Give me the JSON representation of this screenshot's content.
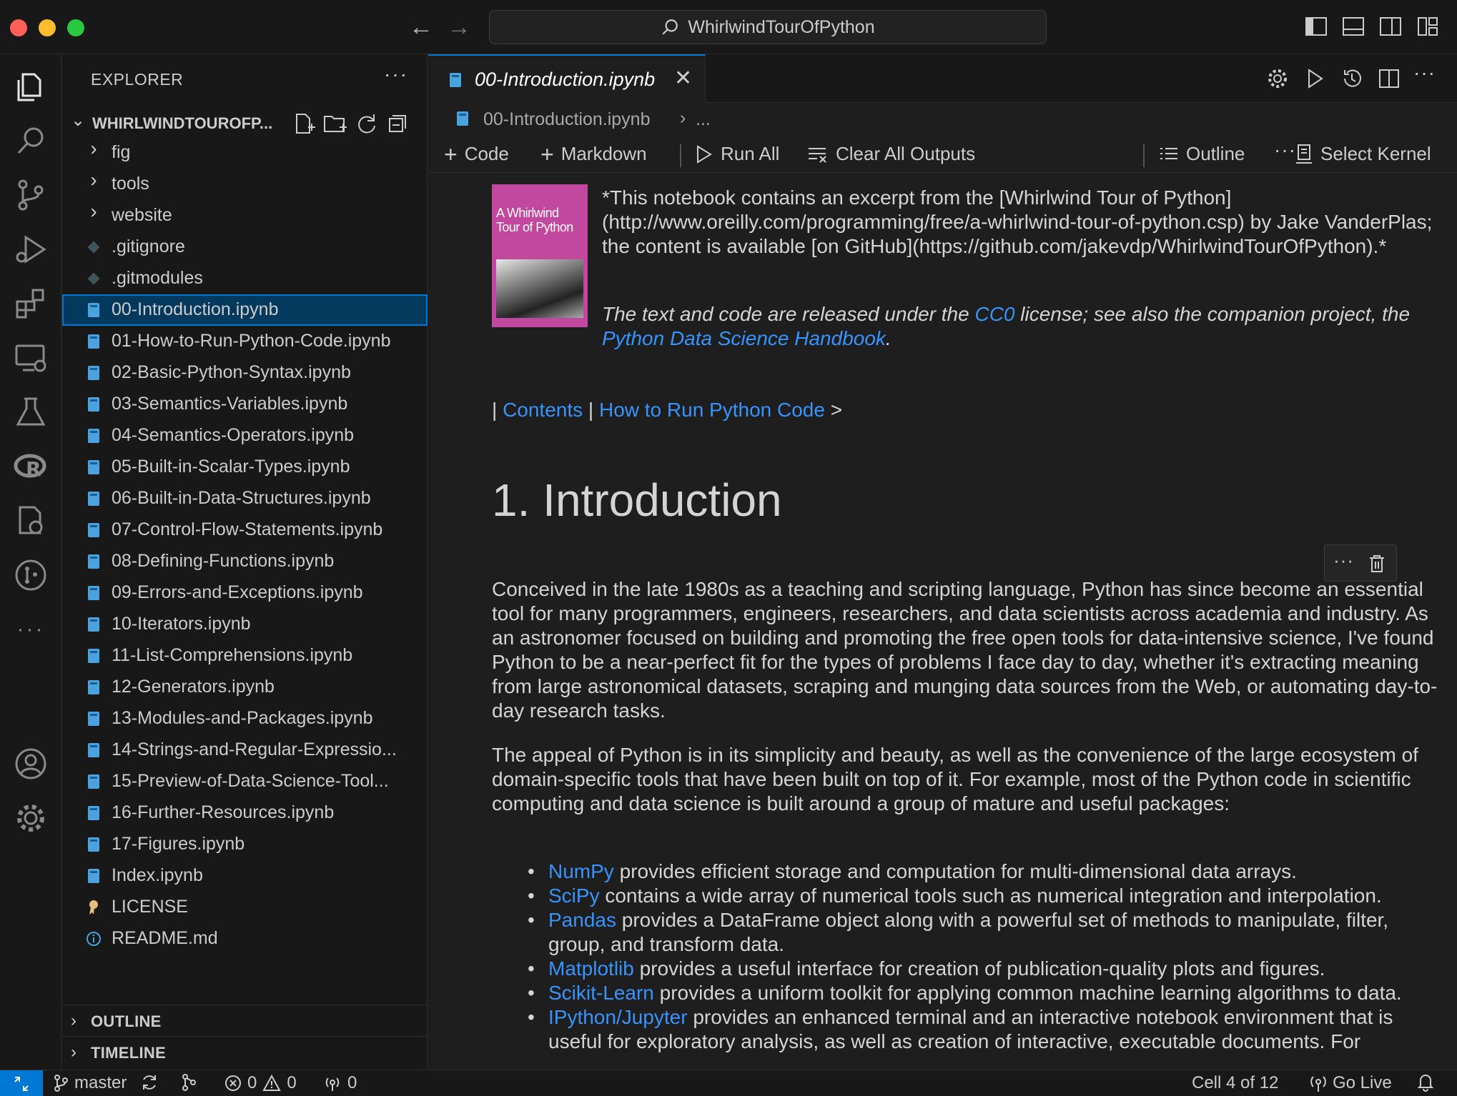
{
  "titlebar": {
    "search_text": "WhirlwindTourOfPython",
    "traffic_lights": {
      "close": "#ff5f57",
      "minimize": "#febc2e",
      "maximize": "#28c840"
    }
  },
  "activity_bar": {
    "icons": [
      "explorer-icon",
      "search-icon",
      "source-control-icon",
      "run-debug-icon",
      "extensions-icon",
      "remote-explorer-icon",
      "testing-icon",
      "r-icon",
      "settings-sync-icon",
      "git-graph-icon",
      "more-icon"
    ],
    "more": "···",
    "bottom_icons": [
      "accounts-icon",
      "manage-gear-icon"
    ]
  },
  "sidebar": {
    "title": "EXPLORER",
    "more": "···",
    "folder_name": "WHIRLWINDTOUROFP...",
    "items": [
      {
        "label": "fig",
        "icon": "chevron-right-icon"
      },
      {
        "label": "tools",
        "icon": "chevron-right-icon"
      },
      {
        "label": "website",
        "icon": "chevron-right-icon"
      },
      {
        "label": ".gitignore",
        "icon": "git-file-icon"
      },
      {
        "label": ".gitmodules",
        "icon": "git-file-icon"
      },
      {
        "label": "00-Introduction.ipynb",
        "icon": "notebook-icon",
        "selected": true
      },
      {
        "label": "01-How-to-Run-Python-Code.ipynb",
        "icon": "notebook-icon"
      },
      {
        "label": "02-Basic-Python-Syntax.ipynb",
        "icon": "notebook-icon"
      },
      {
        "label": "03-Semantics-Variables.ipynb",
        "icon": "notebook-icon"
      },
      {
        "label": "04-Semantics-Operators.ipynb",
        "icon": "notebook-icon"
      },
      {
        "label": "05-Built-in-Scalar-Types.ipynb",
        "icon": "notebook-icon"
      },
      {
        "label": "06-Built-in-Data-Structures.ipynb",
        "icon": "notebook-icon"
      },
      {
        "label": "07-Control-Flow-Statements.ipynb",
        "icon": "notebook-icon"
      },
      {
        "label": "08-Defining-Functions.ipynb",
        "icon": "notebook-icon"
      },
      {
        "label": "09-Errors-and-Exceptions.ipynb",
        "icon": "notebook-icon"
      },
      {
        "label": "10-Iterators.ipynb",
        "icon": "notebook-icon"
      },
      {
        "label": "11-List-Comprehensions.ipynb",
        "icon": "notebook-icon"
      },
      {
        "label": "12-Generators.ipynb",
        "icon": "notebook-icon"
      },
      {
        "label": "13-Modules-and-Packages.ipynb",
        "icon": "notebook-icon"
      },
      {
        "label": "14-Strings-and-Regular-Expressio...",
        "icon": "notebook-icon"
      },
      {
        "label": "15-Preview-of-Data-Science-Tool...",
        "icon": "notebook-icon"
      },
      {
        "label": "16-Further-Resources.ipynb",
        "icon": "notebook-icon"
      },
      {
        "label": "17-Figures.ipynb",
        "icon": "notebook-icon"
      },
      {
        "label": "Index.ipynb",
        "icon": "notebook-icon"
      },
      {
        "label": "LICENSE",
        "icon": "license-icon"
      },
      {
        "label": "README.md",
        "icon": "info-icon"
      }
    ],
    "outline_label": "OUTLINE",
    "timeline_label": "TIMELINE"
  },
  "editor": {
    "tab_label": "00-Introduction.ipynb",
    "tab_close": "✕",
    "breadcrumb": {
      "file": "00-Introduction.ipynb",
      "separator": "›",
      "more": "..."
    },
    "toolbar": {
      "code": "Code",
      "markdown": "Markdown",
      "run_all": "Run All",
      "clear_outputs": "Clear All Outputs",
      "outline": "Outline",
      "more": "···",
      "select_kernel": "Select Kernel"
    },
    "cover": {
      "title_line1": "A Whirlwind",
      "title_line2": "Tour of Python"
    },
    "intro_text": "*This notebook contains an excerpt from the [Whirlwind Tour of Python](http://www.oreilly.com/programming/free/a-whirlwind-tour-of-python.csp) by Jake VanderPlas; the content is available [on GitHub](https://github.com/jakevdp/WhirlwindTourOfPython).*",
    "license": {
      "part1": "The text and code are released under the ",
      "cc0": "CC0",
      "part2": " license; see also the companion project, the ",
      "handbook": "Python Data Science Handbook",
      "part3": "."
    },
    "nav": {
      "bar": "| ",
      "contents": "Contents",
      "sep": " | ",
      "next": "How to Run Python Code",
      "arrow": " >"
    },
    "heading": "1. Introduction",
    "para1": "Conceived in the late 1980s as a teaching and scripting language, Python has since become an essential tool for many programmers, engineers, researchers, and data scientists across academia and industry. As an astronomer focused on building and promoting the free open tools for data-intensive science, I've found Python to be a near-perfect fit for the types of problems I face day to day, whether it's extracting meaning from large astronomical datasets, scraping and munging data sources from the Web, or automating day-to-day research tasks.",
    "para2": "The appeal of Python is in its simplicity and beauty, as well as the convenience of the large ecosystem of domain-specific tools that have been built on top of it. For example, most of the Python code in scientific computing and data science is built around a group of mature and useful packages:",
    "packages": [
      {
        "name": "NumPy",
        "desc": " provides efficient storage and computation for multi-dimensional data arrays."
      },
      {
        "name": "SciPy",
        "desc": " contains a wide array of numerical tools such as numerical integration and interpolation."
      },
      {
        "name": "Pandas",
        "desc": " provides a DataFrame object along with a powerful set of methods to manipulate, filter, group, and transform data."
      },
      {
        "name": "Matplotlib",
        "desc": " provides a useful interface for creation of publication-quality plots and figures."
      },
      {
        "name": "Scikit-Learn",
        "desc": " provides a uniform toolkit for applying common machine learning algorithms to data."
      },
      {
        "name": "IPython/Jupyter",
        "desc": " provides an enhanced terminal and an interactive notebook environment that is useful for exploratory analysis, as well as creation of interactive, executable documents. For"
      }
    ],
    "cell_toolbar_more": "···"
  },
  "statusbar": {
    "branch": "master",
    "errors": "0",
    "warnings": "0",
    "ports": "0",
    "cell_position": "Cell 4 of 12",
    "go_live": "Go Live"
  },
  "colors": {
    "accent": "#0078d4",
    "link": "#3794ff",
    "selection": "#04395e",
    "cover": "#c2479f"
  }
}
